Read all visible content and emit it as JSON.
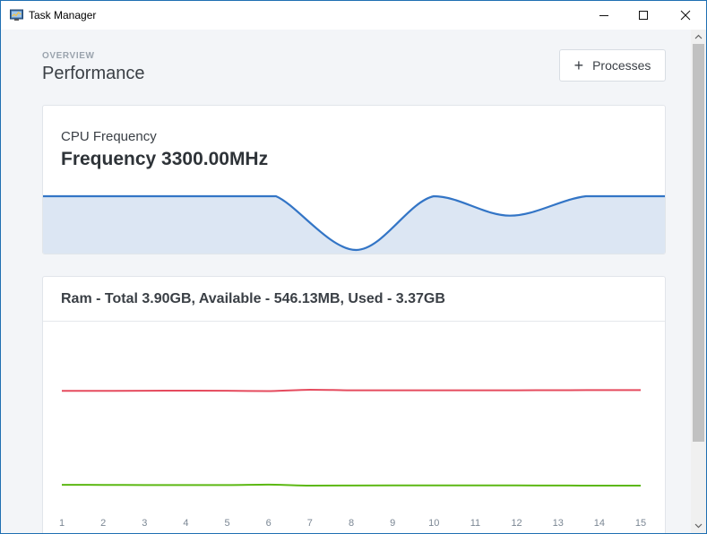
{
  "window": {
    "title": "Task Manager"
  },
  "header": {
    "section_label": "OVERVIEW",
    "title": "Performance",
    "processes_button": "Processes"
  },
  "cpu": {
    "label": "CPU Frequency",
    "value_text": "Frequency 3300.00MHz",
    "chart_data": {
      "type": "area",
      "values": [
        3300,
        3300,
        3300,
        3300,
        3300,
        3300,
        2000,
        3300,
        2830,
        3300,
        3300
      ],
      "color": "#3375c6",
      "fill": "#dce6f3"
    }
  },
  "ram": {
    "title": "Ram - Total 3.90GB, Available - 546.13MB, Used - 3.37GB",
    "chart_data": {
      "type": "line",
      "x": [
        1,
        2,
        3,
        4,
        5,
        6,
        7,
        8,
        9,
        10,
        11,
        12,
        13,
        14,
        15
      ],
      "series": [
        {
          "color": "#e54b5e",
          "values": [
            3.35,
            3.35,
            3.355,
            3.358,
            3.355,
            3.345,
            3.385,
            3.37,
            3.368,
            3.368,
            3.368,
            3.368,
            3.372,
            3.375,
            3.375
          ]
        },
        {
          "color": "#5cb813",
          "values": [
            0.57,
            0.565,
            0.562,
            0.562,
            0.56,
            0.575,
            0.545,
            0.548,
            0.552,
            0.552,
            0.55,
            0.55,
            0.548,
            0.545,
            0.545
          ]
        }
      ]
    }
  }
}
